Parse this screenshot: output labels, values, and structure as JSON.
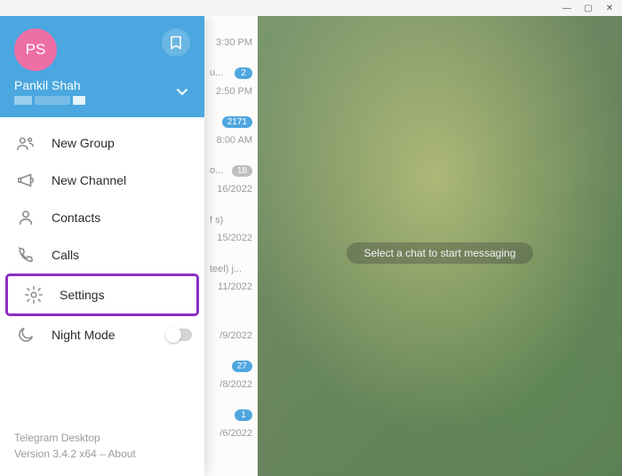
{
  "titlebar": {
    "min": "—",
    "max": "▢",
    "close": "✕"
  },
  "header": {
    "avatar_initials": "PS",
    "name": "Pankil Shah"
  },
  "menu": {
    "new_group": "New Group",
    "new_channel": "New Channel",
    "contacts": "Contacts",
    "calls": "Calls",
    "settings": "Settings",
    "night_mode": "Night Mode"
  },
  "footer": {
    "app": "Telegram Desktop",
    "version": "Version 3.4.2 x64 – About"
  },
  "empty_hint": "Select a chat to start messaging",
  "strip": [
    {
      "time": "3:30 PM",
      "txt": "u...",
      "badge": "2",
      "badge_kind": "blue"
    },
    {
      "time": "2:50 PM",
      "txt": "",
      "badge": "2171",
      "badge_kind": "blue"
    },
    {
      "time": "8:00 AM",
      "txt": "o...",
      "badge": "18",
      "badge_kind": "grey"
    },
    {
      "time": "16/2022",
      "txt": "f s)",
      "badge": "",
      "badge_kind": ""
    },
    {
      "time": "15/2022",
      "txt": "teel) j...",
      "badge": "",
      "badge_kind": ""
    },
    {
      "time": "11/2022",
      "txt": "",
      "badge": "",
      "badge_kind": ""
    },
    {
      "time": "/9/2022",
      "txt": "",
      "badge": "27",
      "badge_kind": "blue"
    },
    {
      "time": "/8/2022",
      "txt": "",
      "badge": "1",
      "badge_kind": "blue"
    },
    {
      "time": "/6/2022",
      "txt": "",
      "badge": "",
      "badge_kind": ""
    }
  ]
}
